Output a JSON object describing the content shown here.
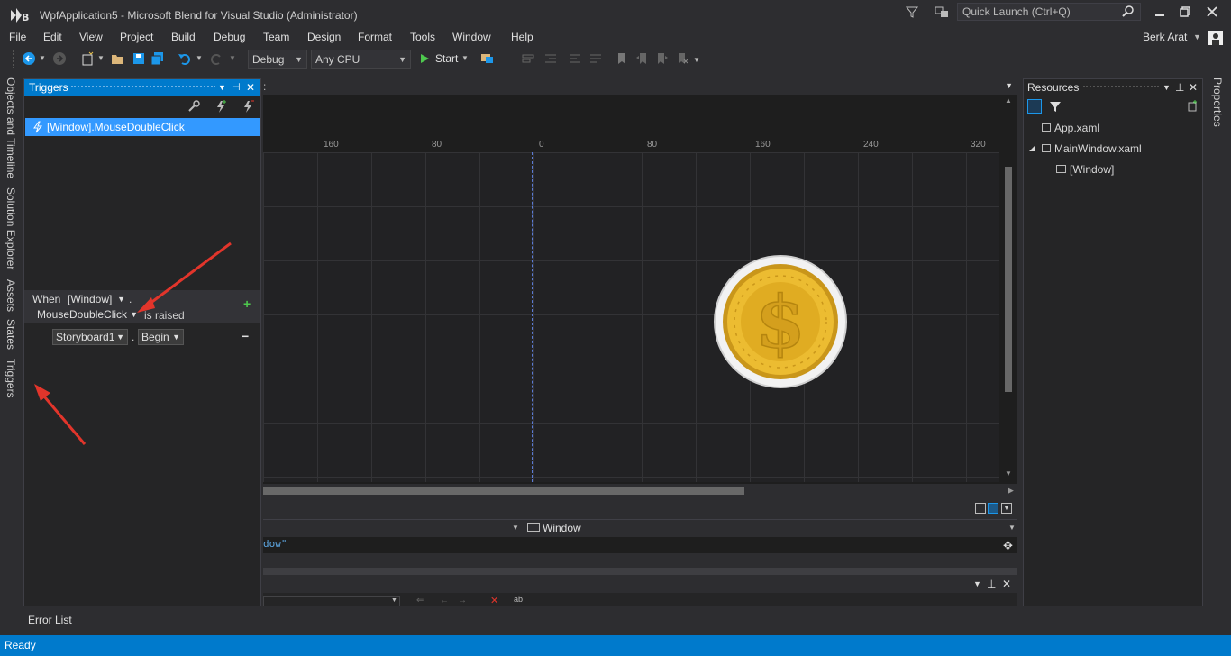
{
  "window": {
    "title": "WpfApplication5 - Microsoft Blend for Visual Studio (Administrator)",
    "quick_launch_placeholder": "Quick Launch (Ctrl+Q)",
    "user": "Berk Arat"
  },
  "menu": [
    "File",
    "Edit",
    "View",
    "Project",
    "Build",
    "Debug",
    "Team",
    "Design",
    "Format",
    "Tools",
    "Window",
    "Help"
  ],
  "toolbar": {
    "config": "Debug",
    "platform": "Any CPU",
    "start_label": "Start"
  },
  "left_tabs": [
    "Objects and Timeline",
    "Solution Explorer",
    "Assets",
    "States",
    "Triggers"
  ],
  "triggers_panel": {
    "title": "Triggers",
    "selected_trigger": "[Window].MouseDoubleClick",
    "when_label": "When",
    "source": "[Window]",
    "dot": ".",
    "event": "MouseDoubleClick",
    "is_raised": "is raised",
    "storyboard": "Storyboard1",
    "action": "Begin",
    "add": "+",
    "remove": "−"
  },
  "ruler_labels": [
    "160",
    "80",
    "0",
    "80",
    "160",
    "240",
    "320"
  ],
  "bottom": {
    "element_combo": "Window",
    "xaml_snippet": "dow\"",
    "error_list": "Error List"
  },
  "resources_panel": {
    "title": "Resources",
    "items": [
      "App.xaml",
      "MainWindow.xaml",
      "[Window]"
    ]
  },
  "right_tab": "Properties",
  "status": "Ready",
  "colors": {
    "accent": "#007acc",
    "selection": "#3399ff",
    "arrow": "#e2352b",
    "coin": "#e7b625"
  }
}
